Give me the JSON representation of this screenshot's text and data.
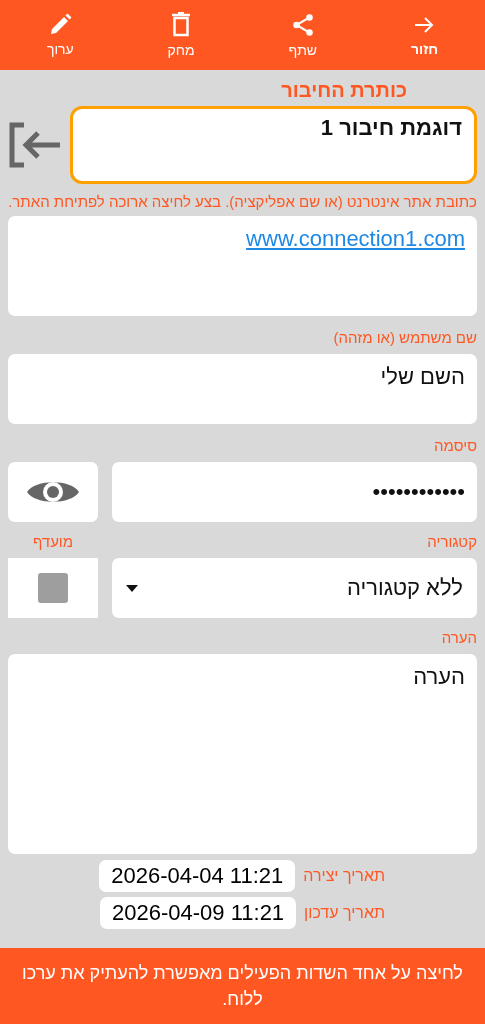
{
  "toolbar": [
    {
      "kind": "back",
      "label": "חזור"
    },
    {
      "kind": "share",
      "label": "שתף"
    },
    {
      "kind": "delete",
      "label": "מחק"
    },
    {
      "kind": "edit",
      "label": "ערוך"
    }
  ],
  "title": {
    "label": "כותרת החיבור",
    "value": "דוגמת חיבור 1"
  },
  "url": {
    "label": "כתובת אתר אינטרנט (או שם אפליקציה). בצע לחיצה ארוכה לפתיחת האתר.",
    "value": "www.connection1.com"
  },
  "username": {
    "label": "שם משתמש (או מזהה)",
    "value": "השם שלי"
  },
  "password": {
    "label": "סיסמה",
    "value": "••••••••••••"
  },
  "category": {
    "label": "קטגוריה",
    "value": "ללא קטגוריה"
  },
  "favorite": {
    "label": "מועדף",
    "checked": false
  },
  "note": {
    "label": "הערה",
    "value": "הערה"
  },
  "dates": [
    {
      "label": "תאריך יצירה",
      "value": "2026-04-04 11:21"
    },
    {
      "label": "תאריך עדכון",
      "value": "2026-04-09 11:21"
    }
  ],
  "toast": "לחיצה על אחד השדות הפעילים מאפשרת להעתיק את ערכו ללוח."
}
